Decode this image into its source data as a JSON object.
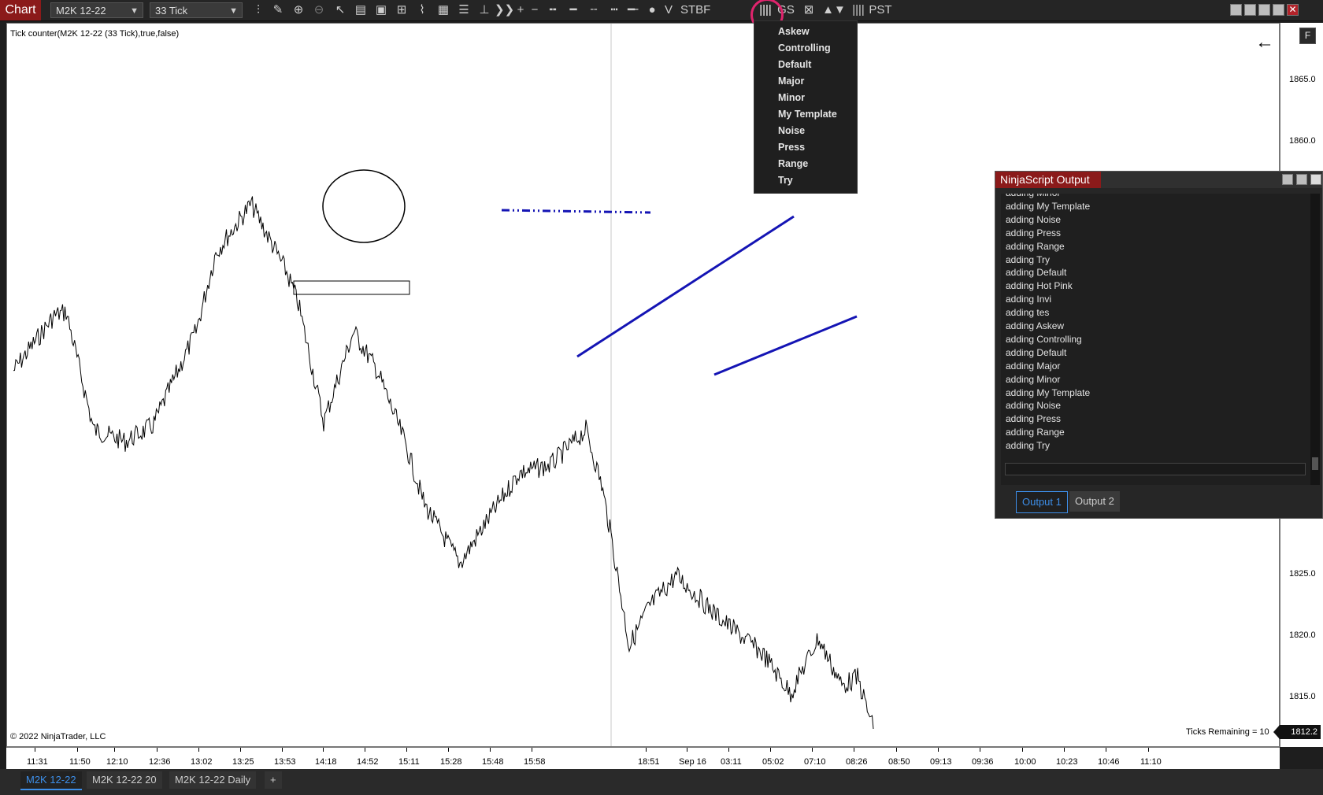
{
  "toolbar": {
    "chart_tab": "Chart",
    "instrument": "M2K 12-22",
    "interval": "33 Tick",
    "items": {
      "v": "V",
      "stbf": "STBF",
      "gs": "GS",
      "pst": "PST"
    }
  },
  "chart": {
    "indicator_label": "Tick counter(M2K 12-22 (33 Tick),true,false)",
    "copyright": "© 2022 NinjaTrader, LLC",
    "ticks_remaining": "Ticks Remaining = 10",
    "current_price": "1812.2",
    "price_labels": [
      "1865.0",
      "1860.0",
      "1825.0",
      "1820.0",
      "1815.0"
    ],
    "time_labels": [
      "11:31",
      "11:50",
      "12:10",
      "12:36",
      "13:02",
      "13:25",
      "13:53",
      "14:18",
      "14:52",
      "15:11",
      "15:28",
      "15:48",
      "15:58",
      "18:51",
      "Sep 16",
      "03:11",
      "05:02",
      "07:10",
      "08:26",
      "08:50",
      "09:13",
      "09:36",
      "10:00",
      "10:23",
      "10:46",
      "11:10"
    ]
  },
  "dropdown": {
    "items": [
      "Askew",
      "Controlling",
      "Default",
      "Major",
      "Minor",
      "My Template",
      "Noise",
      "Press",
      "Range",
      "Try"
    ]
  },
  "ninjascript": {
    "title": "NinjaScript Output",
    "lines": [
      "adding Minor",
      "adding My Template",
      "adding Noise",
      "adding Press",
      "adding Range",
      "adding Try",
      "adding Default",
      "adding Hot Pink",
      "adding Invi",
      "adding tes",
      "adding Askew",
      "adding Controlling",
      "adding Default",
      "adding Major",
      "adding Minor",
      "adding My Template",
      "adding Noise",
      "adding Press",
      "adding Range",
      "adding Try"
    ],
    "tabs": [
      "Output 1",
      "Output 2"
    ]
  },
  "bottom_tabs": [
    "M2K 12-22",
    "M2K 12-22 20",
    "M2K 12-22 Daily",
    "+"
  ],
  "colors": {
    "accent_red": "#8b1a1a",
    "highlight_ring": "#e0246d",
    "drawing_blue": "#1414b4",
    "active_tab": "#3d8ee8"
  }
}
